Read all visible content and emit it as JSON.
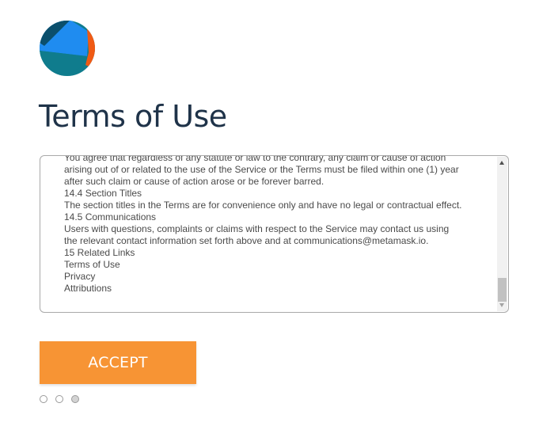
{
  "logo": {
    "icon": "metamask-fox-logo-icon"
  },
  "title": "Terms of Use",
  "terms": {
    "lines": [
      "You agree that regardless of any statute or law to the contrary, any claim or cause of action",
      "arising out of or related to the use of the Service or the Terms must be filed within one (1) year",
      "after such claim or cause of action arose or be forever barred.",
      "14.4 Section Titles",
      "The section titles in the Terms are for convenience only and have no legal or contractual effect.",
      "14.5 Communications",
      "Users with questions, complaints or claims with respect to the Service may contact us using",
      "the relevant contact information set forth above and at communications@metamask.io.",
      "15 Related Links",
      "Terms of Use",
      "Privacy",
      "Attributions"
    ]
  },
  "accept_button": {
    "label": "ACCEPT"
  },
  "pagination": {
    "total": 3,
    "active_index": 2
  },
  "colors": {
    "title": "#1f3349",
    "accent": "#f79434",
    "body_text": "#4a4a4a",
    "logo_blue": "#1f8cf0",
    "logo_teal": "#0f7c8d",
    "logo_dark": "#0b4f6c",
    "logo_orange": "#f05a14"
  }
}
